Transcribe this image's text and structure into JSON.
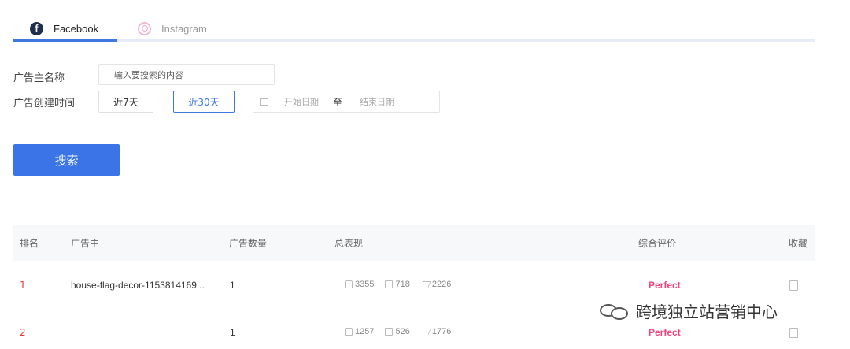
{
  "tabs": [
    {
      "label": "Facebook",
      "active": true,
      "icon": "facebook-icon"
    },
    {
      "label": "Instagram",
      "active": false,
      "icon": "instagram-icon"
    }
  ],
  "form": {
    "advertiser_label": "广告主名称",
    "advertiser_placeholder": "输入要搜索的内容",
    "created_label": "广告创建时间",
    "range_7": "近7天",
    "range_30": "近30天",
    "date_start_placeholder": "开始日期",
    "date_separator": "至",
    "date_end_placeholder": "结束日期",
    "search_button": "搜索"
  },
  "table": {
    "columns": [
      "排名",
      "广告主",
      "广告数量",
      "总表现",
      "综合评价",
      "收藏"
    ],
    "rows": [
      {
        "rank": "1",
        "advertiser": "house-flag-decor-1153814169...",
        "count": "1",
        "likes": "3355",
        "comments": "718",
        "shares": "2226",
        "rating": "Perfect"
      },
      {
        "rank": "2",
        "advertiser": "",
        "count": "1",
        "likes": "1257",
        "comments": "526",
        "shares": "1776",
        "rating": "Perfect"
      }
    ]
  },
  "watermark": {
    "text": "跨境独立站营销中心"
  },
  "colors": {
    "accent": "#3b74e6",
    "rank": "#e53935",
    "rating": "#f0457a"
  }
}
